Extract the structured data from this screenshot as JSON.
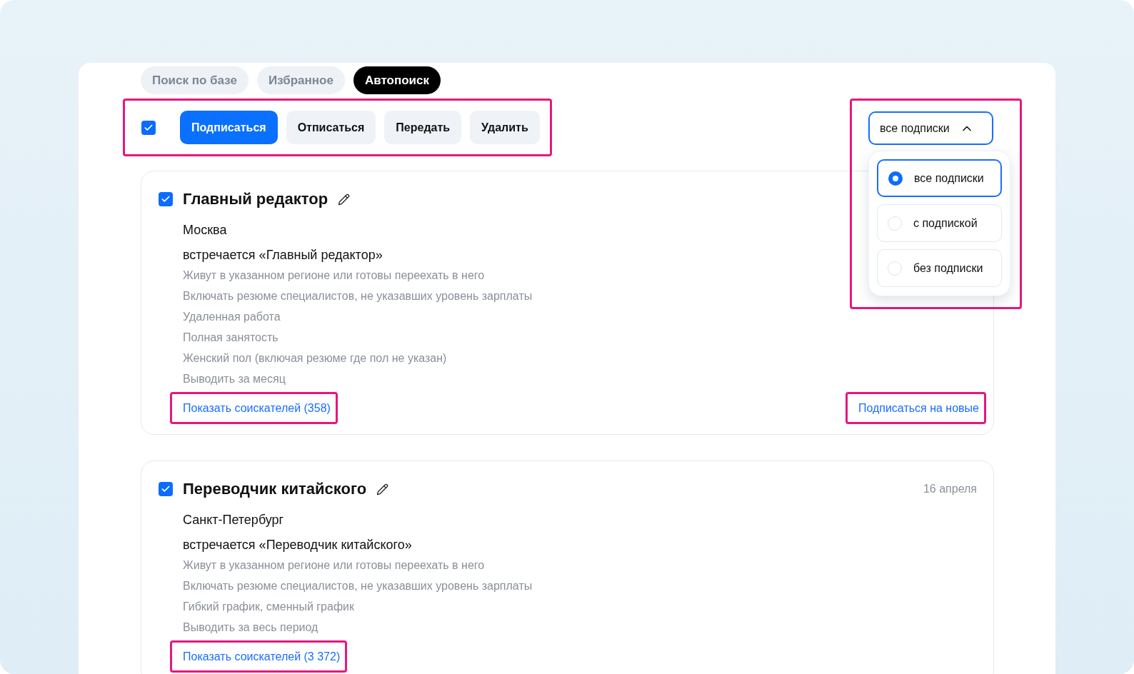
{
  "tabs": [
    {
      "label": "Поиск по базе",
      "selected": false
    },
    {
      "label": "Избранное",
      "selected": false
    },
    {
      "label": "Автопоиск",
      "selected": true
    }
  ],
  "toolbar": {
    "highlighted": true,
    "select_all": {
      "checked": true
    },
    "buttons": [
      {
        "label": "Подписаться",
        "kind": "primary"
      },
      {
        "label": "Отписаться",
        "kind": "secondary"
      },
      {
        "label": "Передать",
        "kind": "secondary"
      },
      {
        "label": "Удалить",
        "kind": "secondary"
      }
    ]
  },
  "filter": {
    "highlighted": true,
    "value": "все подписки",
    "expanded": true,
    "options": [
      {
        "label": "все подписки",
        "selected": true
      },
      {
        "label": "с подпиской",
        "selected": false
      },
      {
        "label": "без подписки",
        "selected": false
      }
    ]
  },
  "subscriptions": [
    {
      "checked": true,
      "title": "Главный редактор",
      "city": "Москва",
      "keyword": "встречается «Главный редактор»",
      "conditions": [
        "Живут в указанном регионе или готовы переехать в него",
        "Включать резюме специалистов, не указавших уровень зарплаты",
        "Удаленная работа",
        "Полная занятость",
        "Женский пол (включая резюме где пол не указан)",
        "Выводить за месяц"
      ],
      "show_link": {
        "text": "Показать соискателей (358)",
        "highlighted": true
      },
      "subscribe_link": {
        "text": "Подписаться на новые",
        "highlighted": true
      }
    },
    {
      "checked": true,
      "title": "Переводчик китайского",
      "date": "16 апреля",
      "city": "Санкт-Петербург",
      "keyword": "встречается «Переводчик китайского»",
      "conditions": [
        "Живут в указанном регионе или готовы переехать в него",
        "Включать резюме специалистов, не указавших уровень зарплаты",
        "Гибкий график, сменный график",
        "Выводить за весь период"
      ],
      "show_link": {
        "text": "Показать соискателей (3 372)",
        "highlighted": true
      }
    }
  ]
}
